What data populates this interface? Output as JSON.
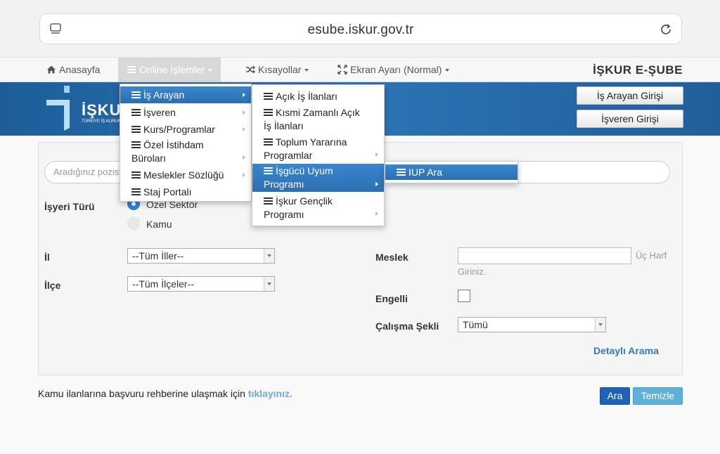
{
  "browser": {
    "url": "esube.iskur.gov.tr"
  },
  "nav": {
    "items": [
      {
        "label": "Anasayfa",
        "icon": "home-icon"
      },
      {
        "label": "Online İşlemler",
        "icon": "list-icon"
      },
      {
        "label": "Kısayollar",
        "icon": "shuffle-icon"
      },
      {
        "label": "Ekran Ayarı (Normal)",
        "icon": "fullscreen-icon"
      }
    ],
    "brand": "İŞKUR E-ŞUBE"
  },
  "header": {
    "logo_text": "İŞKUR",
    "logo_subtitle": "TÜRKİYE İŞ KURUMU",
    "login_seeker": "İş Arayan Girişi",
    "login_employer": "İşveren Girişi"
  },
  "menu1": {
    "items": [
      {
        "label": "İş Arayan"
      },
      {
        "label": "İşveren"
      },
      {
        "label": "Kurs/Programlar"
      },
      {
        "label_l1": "Özel İstihdam",
        "label_l2": "Büroları"
      },
      {
        "label": "Meslekler Sözlüğü"
      },
      {
        "label": "Staj Portalı"
      }
    ]
  },
  "menu2": {
    "items": [
      {
        "label": "Açık İş İlanları"
      },
      {
        "label_l1": "Kısmi Zamanlı Açık",
        "label_l2": "İş İlanları"
      },
      {
        "label_l1": "Toplum Yararına",
        "label_l2": "Programlar"
      },
      {
        "label_l1": "İşgücü Uyum",
        "label_l2": "Programı"
      },
      {
        "label_l1": "İşkur Gençlik",
        "label_l2": "Programı"
      }
    ]
  },
  "menu3": {
    "items": [
      {
        "label": "IUP Ara"
      }
    ]
  },
  "form": {
    "search_placeholder": "Aradığınız pozisyon",
    "isyeri_turu_label": "İşyeri Türü",
    "radio_ozel": "Özel Sektör",
    "radio_kamu": "Kamu",
    "il_label": "İl",
    "il_value": "--Tüm İller--",
    "ilce_label": "İlçe",
    "ilce_value": "--Tüm İlçeler--",
    "meslek_label": "Meslek",
    "meslek_hint_1": "Üç Harf",
    "meslek_hint_2": "Giriniz.",
    "engelli_label": "Engelli",
    "calisma_label": "Çalışma Şekli",
    "calisma_value": "Tümü",
    "detayli": "Detaylı Arama"
  },
  "footer": {
    "text": "Kamu ilanlarına başvuru rehberine ulaşmak için",
    "link": "tıklayınız.",
    "ara": "Ara",
    "temizle": "Temizle"
  }
}
